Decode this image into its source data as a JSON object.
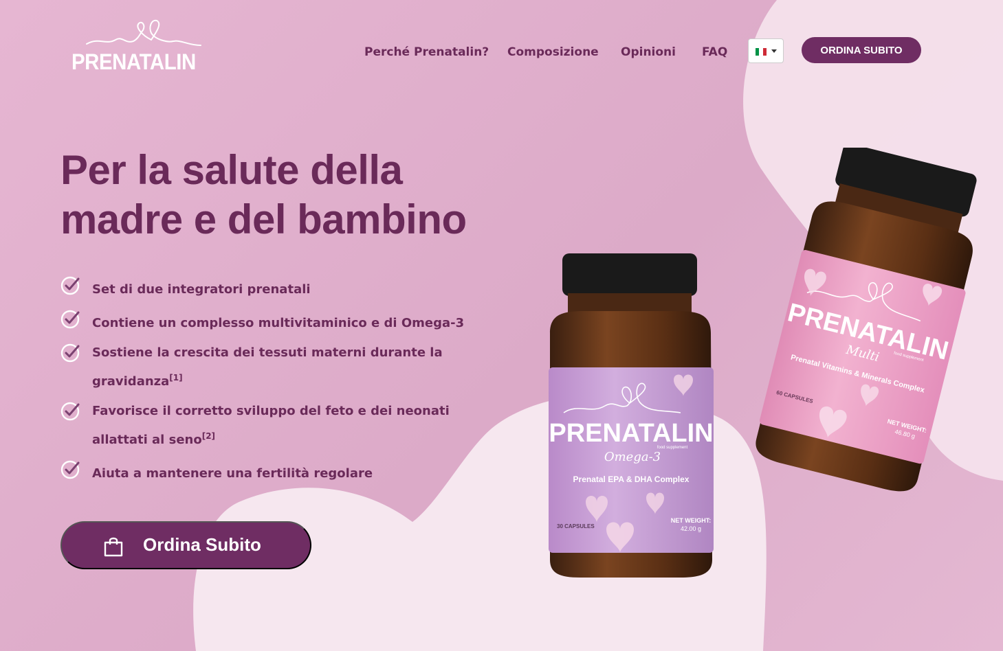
{
  "brand": {
    "logo_text": "PRENATALIN"
  },
  "nav": {
    "items": [
      {
        "label": "Perché Prenatalin?"
      },
      {
        "label": "Composizione"
      },
      {
        "label": "Opinioni"
      },
      {
        "label": "FAQ"
      }
    ],
    "language": "Italiano",
    "order_label": "ORDINA SUBITO"
  },
  "hero": {
    "title_line1": "Per la salute della",
    "title_line2": "madre e del bambino",
    "benefits": [
      {
        "text": "Set di due integratori prenatali",
        "ref": ""
      },
      {
        "text": "Contiene un complesso multivitaminico e di Omega-3",
        "ref": ""
      },
      {
        "text": "Sostiene la crescita dei tessuti materni durante la gravidanza",
        "ref": "[1]"
      },
      {
        "text": "Favorisce il corretto sviluppo del feto e dei neonati allattati al seno",
        "ref": "[2]"
      },
      {
        "text": "Aiuta a mantenere una fertilità regolare",
        "ref": ""
      }
    ],
    "cta_label": "Ordina Subito"
  },
  "products": {
    "omega": {
      "brand": "PRENATALIN",
      "variant": "Omega-3",
      "small": "food supplement",
      "subtitle": "Prenatal EPA & DHA Complex",
      "capsules": "30 CAPSULES",
      "weight_label": "NET WEIGHT:",
      "weight": "42.00 g"
    },
    "multi": {
      "brand": "PRENATALIN",
      "variant": "Multi",
      "small": "food supplement",
      "subtitle": "Prenatal Vitamins & Minerals Complex",
      "capsules": "60 CAPSULES",
      "weight_label": "NET WEIGHT:",
      "weight": "46.80 g"
    }
  },
  "colors": {
    "primary": "#6f2d63",
    "text": "#6a2a59",
    "background": "#e2b3cf",
    "heart": "#f6e6ef"
  }
}
